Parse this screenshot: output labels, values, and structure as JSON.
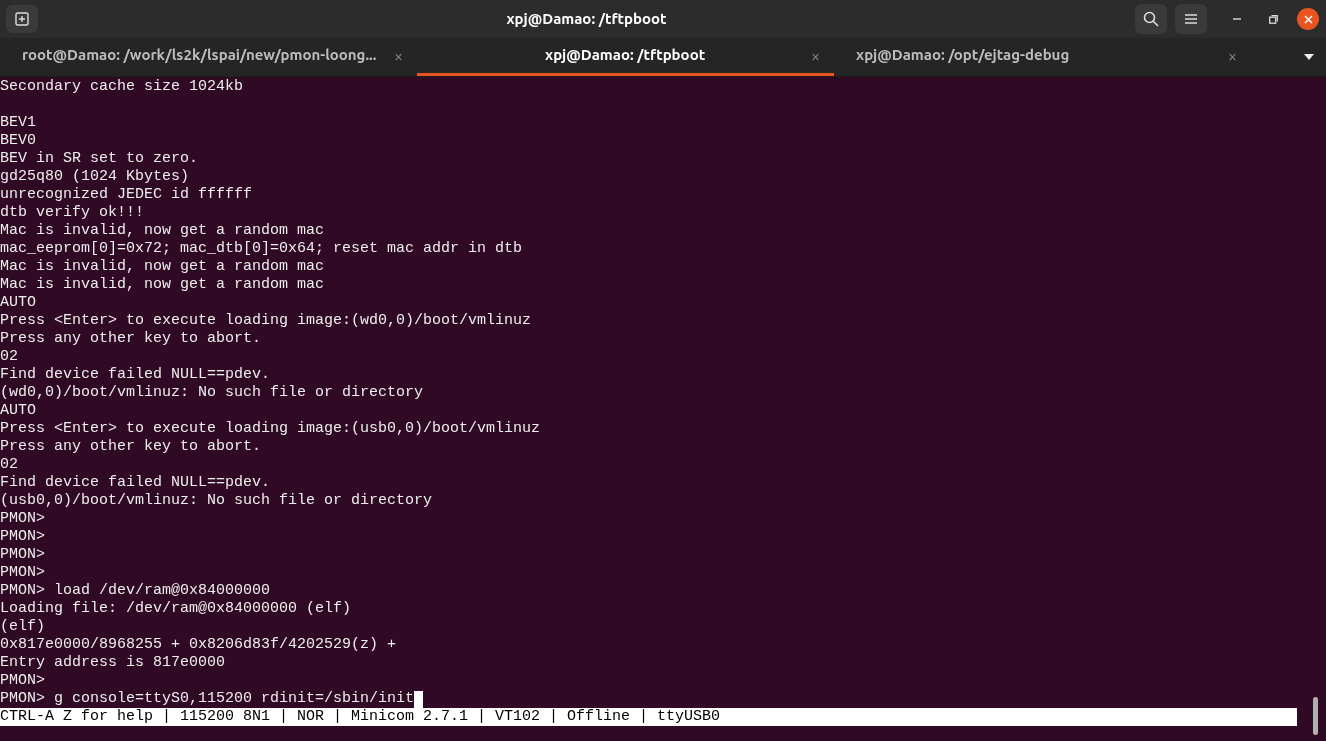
{
  "window": {
    "title": "xpj@Damao: /tftpboot"
  },
  "tabs": [
    {
      "label": "root@Damao: /work/ls2k/lspai/new/pmon-loong...",
      "close": "×",
      "selected": false
    },
    {
      "label": "xpj@Damao: /tftpboot",
      "close": "×",
      "selected": true
    },
    {
      "label": "xpj@Damao: /opt/ejtag-debug",
      "close": "×",
      "selected": false
    }
  ],
  "terminal": {
    "cursor_visible": true,
    "blocks": [
      {
        "lines": [
          "Secondary cache size 1024kb"
        ]
      },
      {
        "lines": [
          "BEV1",
          "BEV0",
          "BEV in SR set to zero.",
          "gd25q80 (1024 Kbytes)",
          "unrecognized JEDEC id ffffff",
          "dtb verify ok!!!",
          "Mac is invalid, now get a random mac",
          "mac_eeprom[0]=0x72; mac_dtb[0]=0x64; reset mac addr in dtb",
          "Mac is invalid, now get a random mac",
          "Mac is invalid, now get a random mac",
          "AUTO",
          "Press <Enter> to execute loading image:(wd0,0)/boot/vmlinuz",
          "Press any other key to abort.",
          "02",
          "Find device failed NULL==pdev.",
          "(wd0,0)/boot/vmlinuz: No such file or directory",
          "AUTO",
          "Press <Enter> to execute loading image:(usb0,0)/boot/vmlinuz",
          "Press any other key to abort.",
          "02",
          "Find device failed NULL==pdev.",
          "(usb0,0)/boot/vmlinuz: No such file or directory",
          "PMON>",
          "PMON>",
          "PMON>",
          "PMON>",
          "PMON> load /dev/ram@0x84000000",
          "Loading file: /dev/ram@0x84000000 (elf)",
          "(elf)",
          "0x817e0000/8968255 + 0x8206d83f/4202529(z) +",
          "Entry address is 817e0000",
          "PMON>",
          "PMON> g console=ttyS0,115200 rdinit=/sbin/init"
        ]
      }
    ],
    "status_bar": "CTRL-A Z for help | 115200 8N1 | NOR | Minicom 2.7.1 | VT102 | Offline | ttyUSB0"
  }
}
